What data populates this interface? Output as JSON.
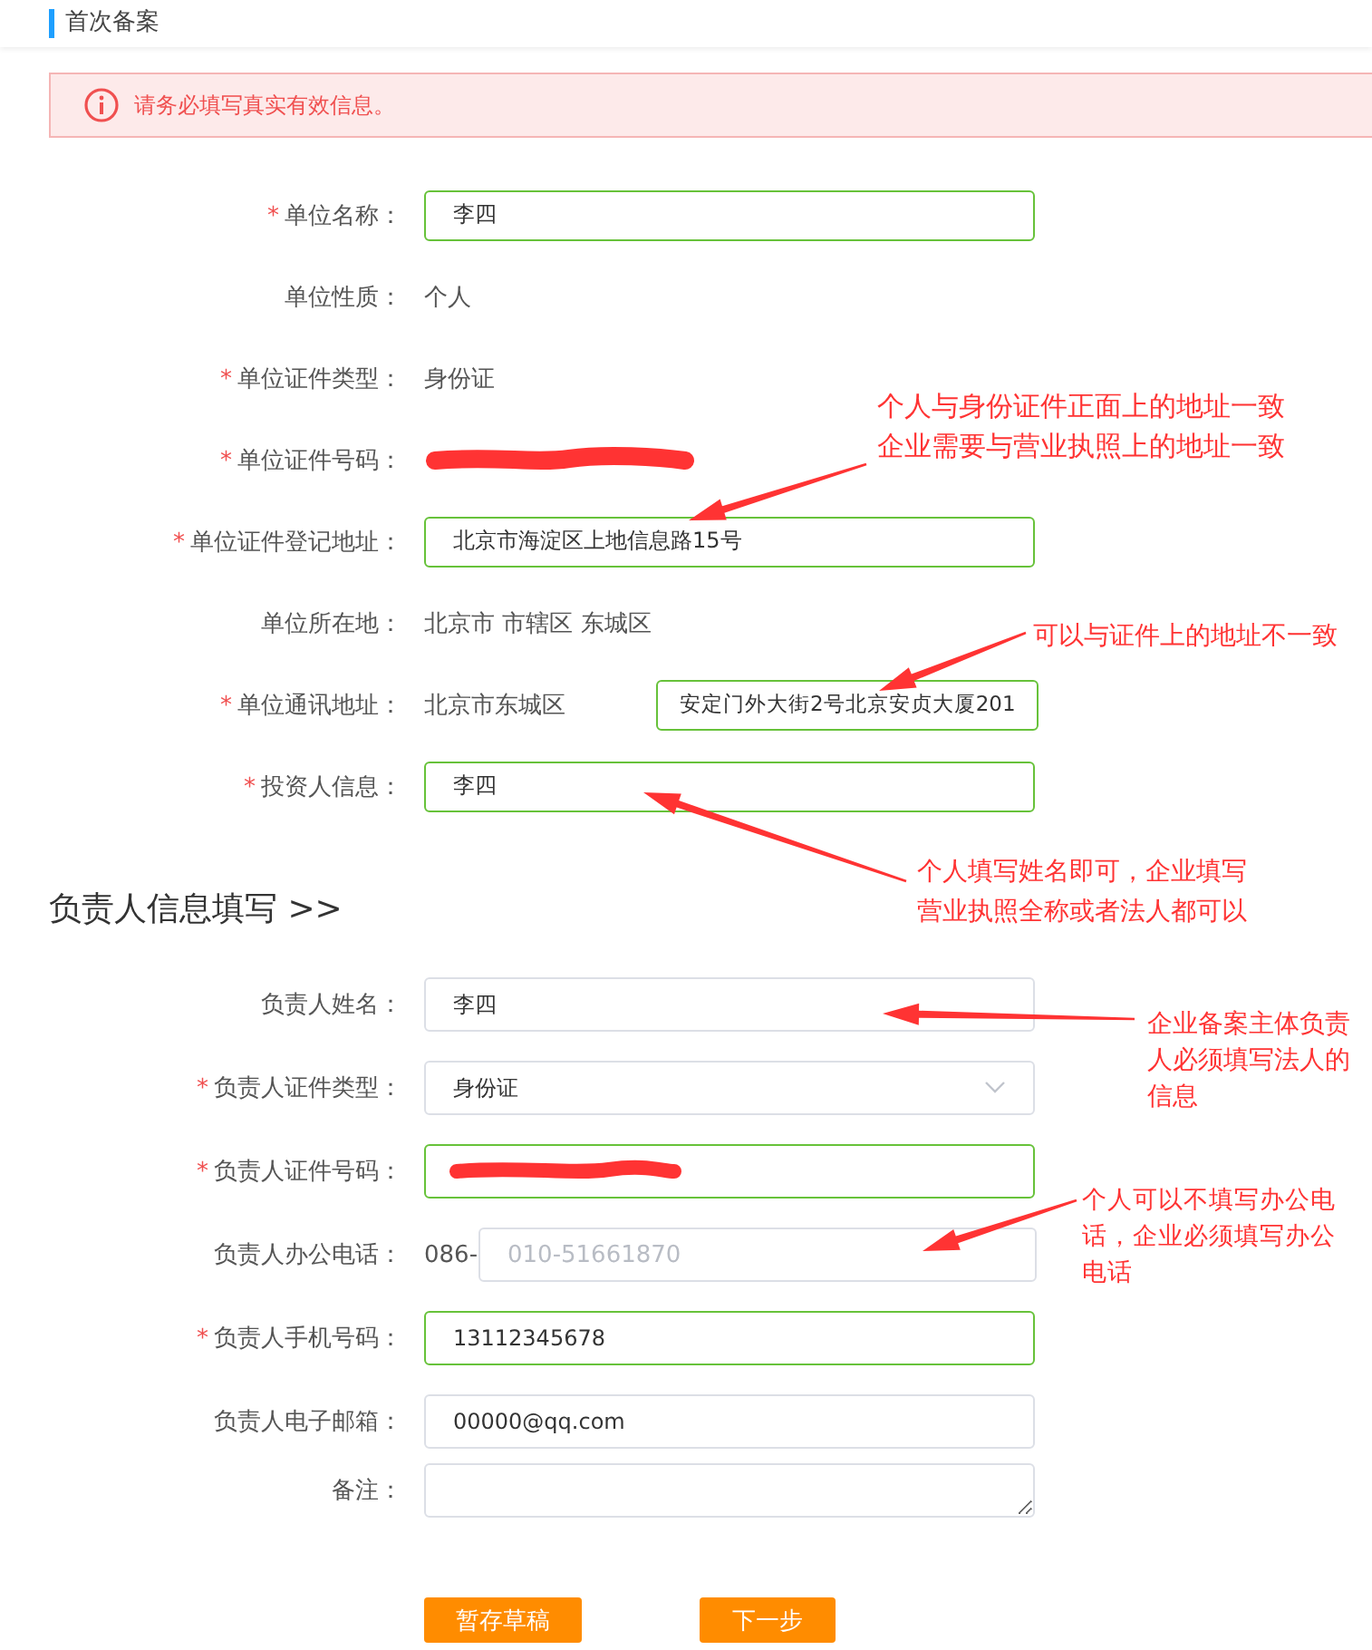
{
  "page_title": "首次备案",
  "alert": {
    "text": "请务必填写真实有效信息。"
  },
  "unit_rows": [
    {
      "label": "单位名称：",
      "mark": "*",
      "kind": "input",
      "value": "李四",
      "valid": true
    },
    {
      "label": "单位性质：",
      "kind": "text",
      "value": "个人"
    },
    {
      "label": "单位证件类型：",
      "mark": "*",
      "kind": "text",
      "value": "身份证"
    },
    {
      "label": "单位证件号码：",
      "mark": "*",
      "kind": "redacted"
    },
    {
      "label": "单位证件登记地址：",
      "mark": "*",
      "kind": "input",
      "value": "北京市海淀区上地信息路15号",
      "valid": true
    },
    {
      "label": "单位所在地：",
      "kind": "text",
      "value": "北京市 市辖区 东城区"
    },
    {
      "label": "单位通讯地址：",
      "mark": "*",
      "kind": "address",
      "prefix": "北京市东城区",
      "value": "安定门外大街2号北京安贞大厦201",
      "valid": true
    },
    {
      "label": "投资人信息：",
      "mark": "*",
      "kind": "input",
      "value": "李四",
      "valid": true
    }
  ],
  "section_title": "负责人信息填写 >>",
  "person_rows": [
    {
      "label": "负责人姓名：",
      "kind": "input",
      "value": "李四",
      "valid": false
    },
    {
      "label": "负责人证件类型：",
      "mark": "*",
      "kind": "select",
      "value": "身份证",
      "valid": false
    },
    {
      "label": "负责人证件号码：",
      "mark": "*",
      "kind": "redacted_input",
      "valid": true
    },
    {
      "label": "负责人办公电话：",
      "kind": "phone",
      "prefix": "086-",
      "placeholder": "010-51661870",
      "valid": false
    },
    {
      "label": "负责人手机号码：",
      "mark": "*",
      "kind": "input",
      "value": "13112345678",
      "valid": true
    },
    {
      "label": "负责人电子邮箱：",
      "kind": "input",
      "value": "00000@qq.com",
      "valid": false
    },
    {
      "label": "备注：",
      "kind": "textarea",
      "valid": false
    }
  ],
  "buttons": [
    "暂存草稿",
    "下一步"
  ],
  "annotations": [
    {
      "lines": [
        "个人与身份证件正面上的地址一致",
        "企业需要与营业执照上的地址一致"
      ]
    },
    {
      "lines": [
        "可以与证件上的地址不一致"
      ]
    },
    {
      "lines": [
        "个人填写姓名即可，企业填写",
        "营业执照全称或者法人都可以"
      ]
    },
    {
      "lines": [
        "企业备案主体负责",
        "人必须填写法人的",
        "信息"
      ]
    },
    {
      "lines": [
        "个人可以不填写办公电",
        "话，企业必须填写办公",
        "电话"
      ]
    }
  ]
}
